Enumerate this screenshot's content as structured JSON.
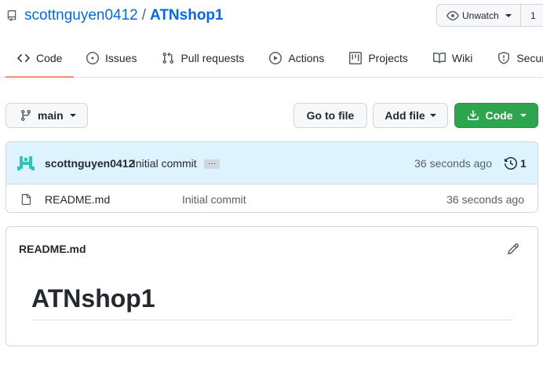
{
  "repo": {
    "owner": "scottnguyen0412",
    "separator": "/",
    "name": "ATNshop1"
  },
  "watch": {
    "label": "Unwatch",
    "count": "1"
  },
  "tabs": [
    {
      "label": "Code",
      "icon": "code-icon",
      "selected": true
    },
    {
      "label": "Issues",
      "icon": "issue-opened-icon"
    },
    {
      "label": "Pull requests",
      "icon": "git-pull-request-icon"
    },
    {
      "label": "Actions",
      "icon": "play-icon"
    },
    {
      "label": "Projects",
      "icon": "project-icon"
    },
    {
      "label": "Wiki",
      "icon": "book-icon"
    },
    {
      "label": "Security",
      "icon": "shield-icon"
    }
  ],
  "branch": {
    "label": "main"
  },
  "buttons": {
    "go_to_file": "Go to file",
    "add_file": "Add file",
    "code": "Code"
  },
  "latest_commit": {
    "author": "scottnguyen0412",
    "message": "Initial commit",
    "ellipsis": "…",
    "time": "36 seconds ago",
    "history_count": "1"
  },
  "files": [
    {
      "name": "README.md",
      "commit": "Initial commit",
      "time": "36 seconds ago"
    }
  ],
  "readme": {
    "title": "README.md",
    "heading": "ATNshop1"
  },
  "colors": {
    "link": "#0969da",
    "primary_button": "#2da44e",
    "selected_tab_underline": "#fd8c73",
    "commit_banner": "#ddf4ff",
    "avatar": "#2ec4b6"
  }
}
